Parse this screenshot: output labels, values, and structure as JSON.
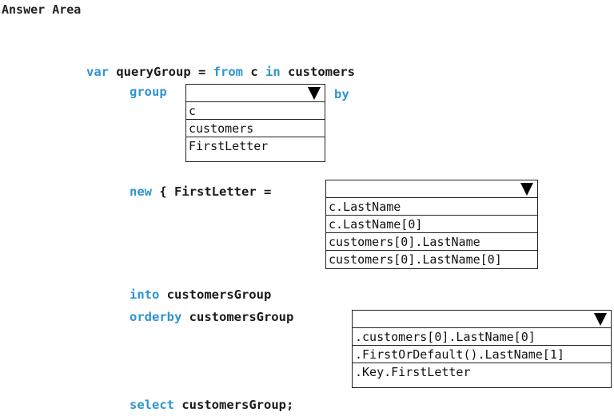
{
  "title": "Answer Area",
  "code": {
    "line1": {
      "kw1": "var",
      "text1": " queryGroup = ",
      "kw2": "from",
      "text2": " c ",
      "kw3": "in",
      "text3": " customers"
    },
    "group_kw": "group",
    "by_kw": "by",
    "new_kw": "new",
    "new_text": " { FirstLetter =",
    "into_kw": "into",
    "into_text": " customersGroup",
    "orderby_kw": "orderby",
    "orderby_text": " customersGroup",
    "select_kw": "select",
    "select_text": " customersGroup;"
  },
  "dropdowns": {
    "group_target": {
      "selected": "",
      "options": [
        "c",
        "customers",
        "FirstLetter"
      ]
    },
    "first_letter_value": {
      "selected": "",
      "options": [
        "c.LastName",
        "c.LastName[0]",
        "customers[0].LastName",
        "customers[0].LastName[0]"
      ]
    },
    "orderby_member": {
      "selected": "",
      "options": [
        ".customers[0].LastName[0]",
        ".FirstOrDefault().LastName[1]",
        ".Key.FirstLetter"
      ]
    }
  },
  "icons": {
    "dropdown_arrow": "triangle-down-icon"
  },
  "colors": {
    "keyword": "#2f95cf",
    "text": "#1a1a1a"
  }
}
